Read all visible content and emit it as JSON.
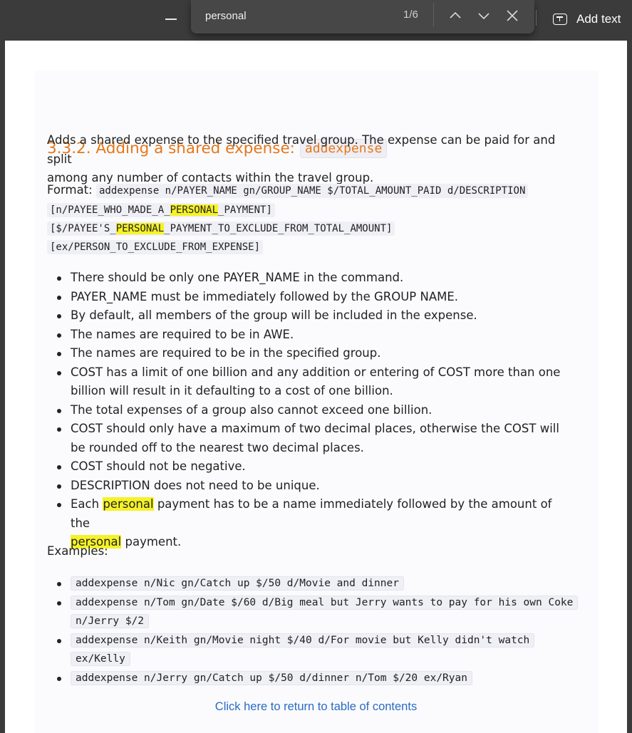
{
  "viewer": {
    "add_text_label": "Add text"
  },
  "find": {
    "query": "personal",
    "count": "1/6"
  },
  "doc": {
    "heading_text": "3.3.2. Adding a shared expense:",
    "heading_code": "addexpense",
    "intro_line1": "Adds a shared expense to the specified travel group. The expense can be paid for and split",
    "intro_line2": "among any number of contacts within the travel group.",
    "format_label": "Format:",
    "format_line1": "addexpense n/PAYER_NAME gn/GROUP_NAME $/TOTAL_AMOUNT_PAID d/DESCRIPTION",
    "format_line2_a": "[n/PAYEE_WHO_MADE_A_",
    "format_line2_hl": "PERSONAL",
    "format_line2_b": "_PAYMENT]",
    "format_line3_a": "[$/PAYEE'S_",
    "format_line3_hl": "PERSONAL",
    "format_line3_b": "_PAYMENT_TO_EXCLUDE_FROM_TOTAL_AMOUNT]",
    "format_line4": "[ex/PERSON_TO_EXCLUDE_FROM_EXPENSE]",
    "bullets": [
      "There should be only one PAYER_NAME in the command.",
      "PAYER_NAME must be immediately followed by the GROUP NAME.",
      "By default, all members of the group will be included in the expense.",
      "The names are required to be in AWE.",
      "The names are required to be in the specified group.",
      "COST has a limit of one billion and any addition or entering of COST more than one billion will result in it defaulting to a cost of one billion.",
      "The total expenses of a group also cannot exceed one billion.",
      "COST should only have a maximum of two decimal places, otherwise the COST will be rounded off to the nearest two decimal places.",
      "COST should not be negative.",
      "DESCRIPTION does not need to be unique."
    ],
    "last_bullet_a": "Each ",
    "last_bullet_hl1": "personal",
    "last_bullet_b": " payment has to be a name immediately followed by the amount of the",
    "last_bullet_hl2": "personal",
    "last_bullet_c": " payment.",
    "examples_label": "Examples:",
    "examples": [
      "addexpense n/Nic gn/Catch up $/50 d/Movie and dinner",
      "addexpense n/Tom gn/Date $/60 d/Big meal but Jerry wants to pay for his own Coke n/Jerry $/2",
      "addexpense n/Keith gn/Movie night $/40 d/For movie but Kelly didn't watch ex/Kelly",
      "addexpense n/Jerry gn/Catch up $/50 d/dinner n/Tom $/20 ex/Ryan"
    ],
    "toc_link": "Click here to return to table of contents"
  },
  "colors": {
    "heading": "#e6771a",
    "highlight": "#f5f227",
    "link": "#2a6bc2",
    "chrome": "#3b3b3b"
  }
}
